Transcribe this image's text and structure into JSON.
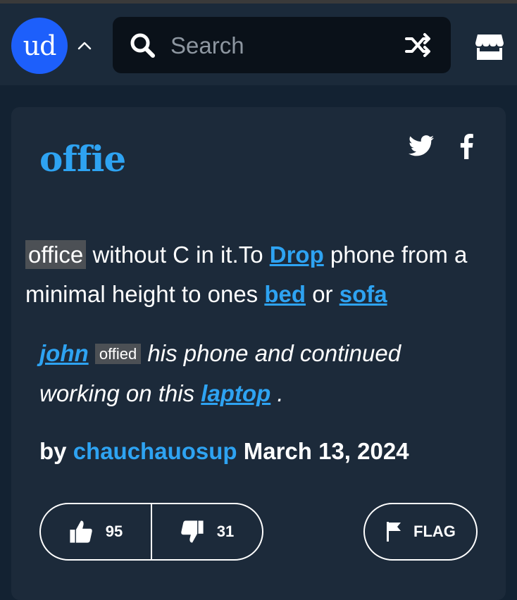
{
  "header": {
    "logo_text": "ud",
    "search": {
      "placeholder": "Search"
    }
  },
  "definition": {
    "word": "offie",
    "meaning": {
      "highlight": "office",
      "text1": " without C in it.To ",
      "link_drop": "Drop",
      "text2": " phone from a minimal height to ones ",
      "link_bed": "bed",
      "text3": " or ",
      "link_sofa": "sofa"
    },
    "example": {
      "link_john": "john",
      "highlight": "offied",
      "text1": " his phone and continued working on this ",
      "link_laptop": "laptop",
      "text2": " ."
    },
    "byline": {
      "prefix": "by ",
      "author": "chauchauosup",
      "date": " March 13, 2024"
    },
    "votes": {
      "up": "95",
      "down": "31"
    },
    "flag_label": "FLAG"
  },
  "colors": {
    "accent": "#2ea3f2",
    "logo": "#1d5ffb",
    "card": "#1c2a3a",
    "background": "#132232"
  },
  "icons": [
    "chevron-up-icon",
    "search-icon",
    "shuffle-icon",
    "store-icon",
    "twitter-icon",
    "facebook-icon",
    "thumbs-up-icon",
    "thumbs-down-icon",
    "flag-icon"
  ]
}
